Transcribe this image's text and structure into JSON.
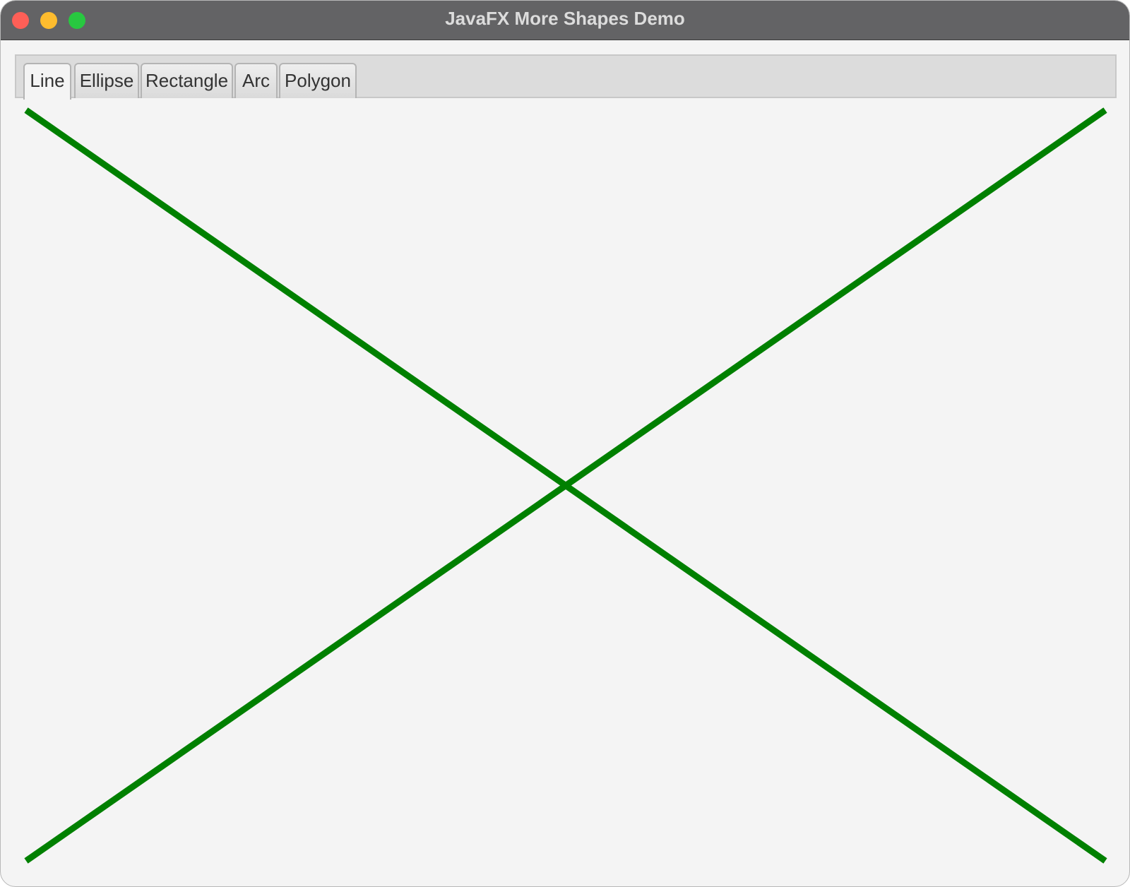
{
  "window": {
    "title": "JavaFX More Shapes Demo"
  },
  "tabs": [
    {
      "label": "Line",
      "selected": true
    },
    {
      "label": "Ellipse",
      "selected": false
    },
    {
      "label": "Rectangle",
      "selected": false
    },
    {
      "label": "Arc",
      "selected": false
    },
    {
      "label": "Polygon",
      "selected": false
    }
  ],
  "line_tab": {
    "stroke_color": "#008000"
  },
  "colors": {
    "titlebar": "#636365",
    "content_background": "#f4f4f4",
    "close": "#fe5f57",
    "minimize": "#febc2e",
    "maximize": "#28c840"
  }
}
